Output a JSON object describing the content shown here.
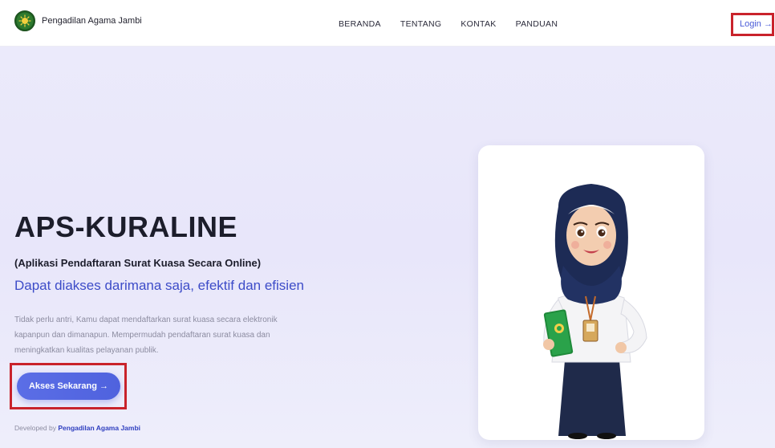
{
  "header": {
    "brand_name": "Pengadilan Agama Jambi",
    "logo_icon": "court-emblem-icon",
    "nav": [
      {
        "label": "BERANDA"
      },
      {
        "label": "TENTANG"
      },
      {
        "label": "KONTAK"
      },
      {
        "label": "PANDUAN"
      }
    ],
    "login_label": "Login →"
  },
  "hero": {
    "title": "APS-KURALINE",
    "subtitle": "(Aplikasi Pendaftaran Surat Kuasa Secara Online)",
    "tagline": "Dapat diakses darimana saja, efektif dan efisien",
    "description": "Tidak perlu antri, Kamu dapat mendaftarkan surat kuasa secara elektronik kapanpun dan dimanapun. Mempermudah pendaftaran surat kuasa dan meningkatkan kualitas pelayanan publik.",
    "cta_label": "Akses Sekarang →"
  },
  "footer": {
    "credit_prefix": "Developed by",
    "credit_link": "Pengadilan Agama Jambi"
  },
  "illustration": {
    "icon": "hijab-woman-mascot-icon"
  },
  "colors": {
    "accent": "#4f62de",
    "tagline": "#3d4cc8",
    "highlight_border": "#c9232b",
    "background": "#ecebfb"
  }
}
